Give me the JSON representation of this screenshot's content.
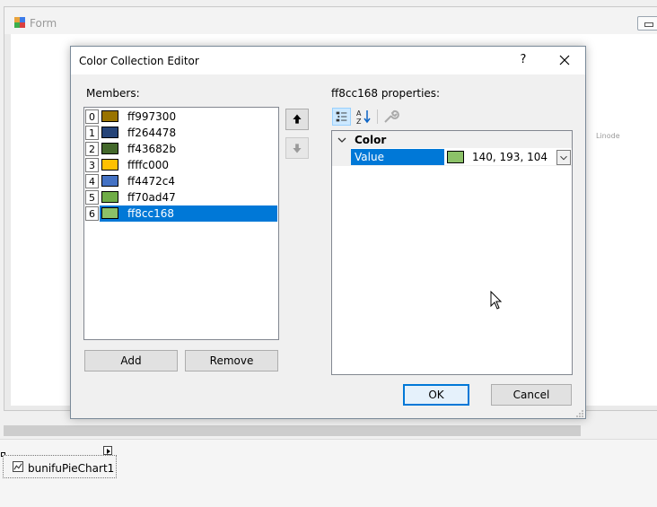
{
  "background_form": {
    "title": "Form",
    "side_label": "Linode"
  },
  "component_tray": {
    "item_label": "bunifuPieChart1"
  },
  "dialog": {
    "title": "Color Collection Editor",
    "help": "?",
    "members_label": "Members:",
    "properties_label": "ff8cc168 properties:",
    "members": [
      {
        "index": "0",
        "label": "ff997300",
        "color": "#997300"
      },
      {
        "index": "1",
        "label": "ff264478",
        "color": "#264478"
      },
      {
        "index": "2",
        "label": "ff43682b",
        "color": "#43682b"
      },
      {
        "index": "3",
        "label": "ffffc000",
        "color": "#ffc000"
      },
      {
        "index": "4",
        "label": "ff4472c4",
        "color": "#4472c4"
      },
      {
        "index": "5",
        "label": "ff70ad47",
        "color": "#70ad47"
      },
      {
        "index": "6",
        "label": "ff8cc168",
        "color": "#8cc168"
      }
    ],
    "selected_index": 6,
    "add_label": "Add",
    "remove_label": "Remove",
    "property_grid": {
      "category": "Color",
      "property_name": "Value",
      "property_value": "140, 193, 104",
      "swatch_color": "#8cc168"
    },
    "ok_label": "OK",
    "cancel_label": "Cancel"
  },
  "colors": {
    "selection": "#0078d7"
  }
}
